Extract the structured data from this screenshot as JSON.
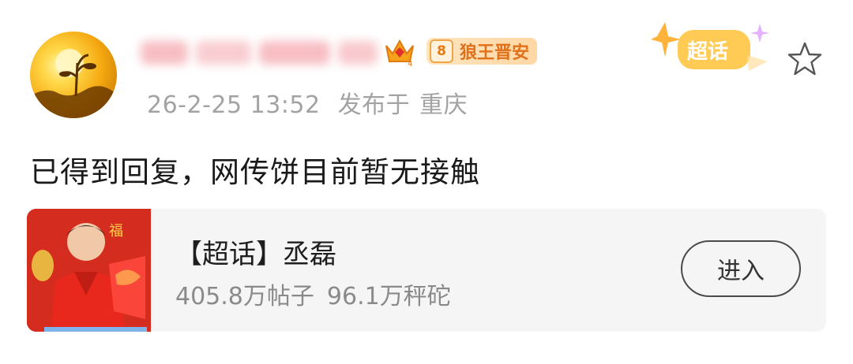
{
  "post": {
    "username_blurred": true,
    "badge": {
      "level": "8",
      "label": "狼王晋安"
    },
    "supertopic_badge": "超话",
    "timestamp": "26-2-25 13:52",
    "location_prefix": "发布于",
    "location": "重庆",
    "text": "已得到回复，网传饼目前暂无接触"
  },
  "topic_card": {
    "title": "【超话】丞磊",
    "posts": "405.8万帖子",
    "followers": "96.1万秤砣",
    "button_label": "进入",
    "image_text": "福"
  },
  "colors": {
    "accent_orange": "#e0701a",
    "meta_gray": "#a3a3a3",
    "card_bg": "#f5f5f5",
    "red_bg": "#d02a1c"
  }
}
